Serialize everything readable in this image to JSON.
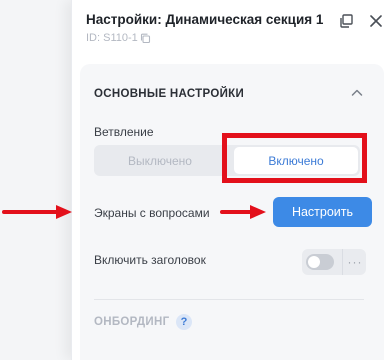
{
  "header": {
    "title": "Настройки: Динамическая секция 1",
    "id_label": "ID: S110-1",
    "icons": {
      "popout": "popout-window-icon",
      "close": "close-icon",
      "copy": "copy-icon"
    }
  },
  "section": {
    "title": "ОСНОВНЫЕ НАСТРОЙКИ",
    "chevron": "chevron-up-icon",
    "branching": {
      "label": "Ветвление",
      "options": [
        "Выключено",
        "Включено"
      ],
      "selected": "Включено"
    },
    "screens": {
      "label": "Экраны с вопросами",
      "button_label": "Настроить"
    },
    "header_toggle": {
      "label": "Включить заголовок",
      "enabled": false,
      "more_label": "···"
    }
  },
  "onboarding": {
    "title": "ОНБОРДИНГ",
    "help_label": "?"
  },
  "colors": {
    "accent": "#3d8ae6",
    "selected_text": "#3c7bd6",
    "highlight": "#e3101b",
    "panel_bg": "#f6f7f9"
  }
}
